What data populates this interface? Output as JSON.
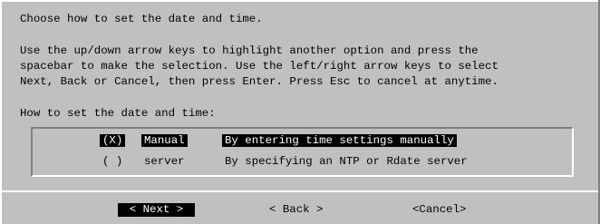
{
  "dialog": {
    "prompt": "Choose how to set the date and time.",
    "instructions": [
      "Use the up/down arrow keys to highlight another option and press the",
      "spacebar to make the selection. Use the left/right arrow keys to select",
      "Next, Back or Cancel, then press Enter. Press Esc to cancel at anytime."
    ],
    "subheading": "How to set the date and time:",
    "options": [
      {
        "mark": "(X)",
        "name": "Manual",
        "description": "By entering time settings manually",
        "selected": true
      },
      {
        "mark": "( )",
        "name": "server",
        "description": "By specifying an NTP or Rdate server",
        "selected": false
      }
    ],
    "buttons": {
      "next": "< Next >",
      "back": "< Back >",
      "cancel": "<Cancel>"
    }
  }
}
